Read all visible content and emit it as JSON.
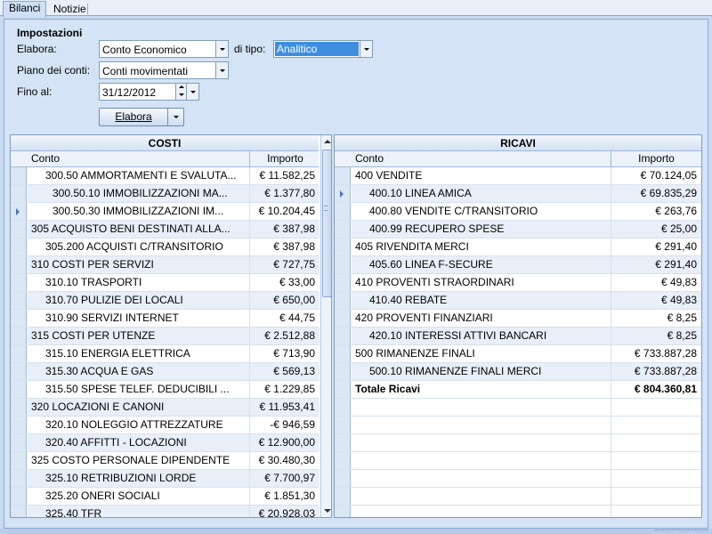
{
  "tabs": [
    {
      "label": "Bilanci",
      "active": true
    },
    {
      "label": "Notizie",
      "active": false
    }
  ],
  "settings": {
    "title": "Impostazioni",
    "elabora_label": "Elabora:",
    "elabora_value": "Conto Economico",
    "tipo_label": "di tipo:",
    "tipo_value": "Analitico",
    "piano_label": "Piano dei conti:",
    "piano_value": "Conti movimentati",
    "fino_label": "Fino al:",
    "fino_value": "31/12/2012",
    "button_label": "Elabora"
  },
  "costi": {
    "title": "COSTI",
    "col_conto": "Conto",
    "col_importo": "Importo",
    "rows": [
      {
        "name": "300.50 AMMORTAMENTI E SVALUTA...",
        "amount": "€ 11.582,25",
        "level": 2
      },
      {
        "name": "300.50.10 IMMOBILIZZAZIONI MA...",
        "amount": "€ 1.377,80",
        "level": 3
      },
      {
        "name": "300.50.30 IMMOBILIZZAZIONI IM...",
        "amount": "€ 10.204,45",
        "level": 3,
        "current": true
      },
      {
        "name": "305 ACQUISTO BENI DESTINATI ALLA...",
        "amount": "€ 387,98",
        "level": 1
      },
      {
        "name": "305.200 ACQUISTI C/TRANSITORIO",
        "amount": "€ 387,98",
        "level": 2
      },
      {
        "name": "310 COSTI PER SERVIZI",
        "amount": "€ 727,75",
        "level": 1
      },
      {
        "name": "310.10 TRASPORTI",
        "amount": "€ 33,00",
        "level": 2
      },
      {
        "name": "310.70 PULIZIE DEI LOCALI",
        "amount": "€ 650,00",
        "level": 2
      },
      {
        "name": "310.90 SERVIZI INTERNET",
        "amount": "€ 44,75",
        "level": 2
      },
      {
        "name": "315 COSTI PER UTENZE",
        "amount": "€ 2.512,88",
        "level": 1
      },
      {
        "name": "315.10 ENERGIA ELETTRICA",
        "amount": "€ 713,90",
        "level": 2
      },
      {
        "name": "315.30 ACQUA E GAS",
        "amount": "€ 569,13",
        "level": 2
      },
      {
        "name": "315.50 SPESE TELEF. DEDUCIBILI ...",
        "amount": "€ 1.229,85",
        "level": 2
      },
      {
        "name": "320 LOCAZIONI E CANONI",
        "amount": "€ 11.953,41",
        "level": 1
      },
      {
        "name": "320.10 NOLEGGIO ATTREZZATURE",
        "amount": "-€ 946,59",
        "level": 2
      },
      {
        "name": "320.40 AFFITTI - LOCAZIONI",
        "amount": "€ 12.900,00",
        "level": 2
      },
      {
        "name": "325 COSTO PERSONALE DIPENDENTE",
        "amount": "€ 30.480,30",
        "level": 1
      },
      {
        "name": "325.10 RETRIBUZIONI LORDE",
        "amount": "€ 7.700,97",
        "level": 2
      },
      {
        "name": "325.20 ONERI SOCIALI",
        "amount": "€ 1.851,30",
        "level": 2
      },
      {
        "name": "325.40 TFR",
        "amount": "€ 20.928,03",
        "level": 2
      }
    ]
  },
  "ricavi": {
    "title": "RICAVI",
    "col_conto": "Conto",
    "col_importo": "Importo",
    "rows": [
      {
        "name": "400 VENDITE",
        "amount": "€ 70.124,05",
        "level": 1
      },
      {
        "name": "400.10 LINEA AMICA",
        "amount": "€ 69.835,29",
        "level": 2,
        "current": true
      },
      {
        "name": "400.80 VENDITE C/TRANSITORIO",
        "amount": "€ 263,76",
        "level": 2
      },
      {
        "name": "400.99 RECUPERO SPESE",
        "amount": "€ 25,00",
        "level": 2
      },
      {
        "name": "405 RIVENDITA MERCI",
        "amount": "€ 291,40",
        "level": 1
      },
      {
        "name": "405.60 LINEA F-SECURE",
        "amount": "€ 291,40",
        "level": 2
      },
      {
        "name": "410 PROVENTI STRAORDINARI",
        "amount": "€ 49,83",
        "level": 1
      },
      {
        "name": "410.40 REBATE",
        "amount": "€ 49,83",
        "level": 2
      },
      {
        "name": "420 PROVENTI FINANZIARI",
        "amount": "€ 8,25",
        "level": 1
      },
      {
        "name": "420.10 INTERESSI ATTIVI BANCARI",
        "amount": "€ 8,25",
        "level": 2
      },
      {
        "name": "500 RIMANENZE FINALI",
        "amount": "€ 733.887,28",
        "level": 1
      },
      {
        "name": "500.10 RIMANENZE FINALI MERCI",
        "amount": "€ 733.887,28",
        "level": 2
      },
      {
        "name": "Totale Ricavi",
        "amount": "€ 804.360,81",
        "level": 1,
        "total": true
      }
    ],
    "empty_rows": 7
  },
  "colors": {
    "background": "#c9daf0",
    "panel": "#d4e3f5",
    "selection": "#3f8ee0",
    "alt_row": "#e8eff9"
  }
}
